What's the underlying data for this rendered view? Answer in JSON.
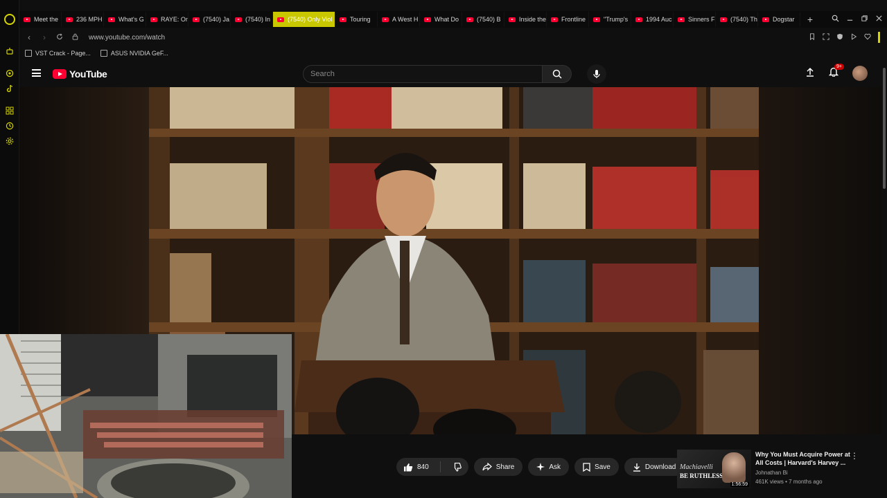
{
  "browser": {
    "tabs": [
      {
        "label": "Meet the",
        "active": false
      },
      {
        "label": "236 MPH",
        "active": false
      },
      {
        "label": "What's G",
        "active": false
      },
      {
        "label": "RAYE: On",
        "active": false
      },
      {
        "label": "(7540) Ja",
        "active": false
      },
      {
        "label": "(7540) In",
        "active": false
      },
      {
        "label": "(7540) Only Viol",
        "active": true
      },
      {
        "label": "Touring",
        "active": false
      },
      {
        "label": "A West H",
        "active": false
      },
      {
        "label": "What Do",
        "active": false
      },
      {
        "label": "(7540) B",
        "active": false
      },
      {
        "label": "Inside the",
        "active": false
      },
      {
        "label": "Frontline",
        "active": false
      },
      {
        "label": "\"Trump's",
        "active": false
      },
      {
        "label": "1994 Auc",
        "active": false
      },
      {
        "label": "Sinners F",
        "active": false
      },
      {
        "label": "(7540) Th",
        "active": false
      },
      {
        "label": "Dogstar",
        "active": false
      }
    ],
    "url": "www.youtube.com/watch",
    "bookmarks": [
      {
        "label": "VST Crack - Page..."
      },
      {
        "label": "ASUS NVIDIA GeF..."
      }
    ],
    "accent_color": "#d7d600"
  },
  "youtube": {
    "logo_text": "YouTube",
    "search_placeholder": "Search",
    "notification_count": "9+",
    "actions": {
      "like_count": "840",
      "share_label": "Share",
      "ask_label": "Ask",
      "save_label": "Save",
      "download_label": "Download"
    },
    "recommendation": {
      "title": "Why You Must Acquire Power at All Costs | Harvard's Harvey ...",
      "channel": "Johnathan Bi",
      "meta": "461K views • 7 months ago",
      "thumb_line1": "Machiavelli",
      "thumb_line2": "BE RUTHLESS",
      "duration": "1:56:59"
    }
  }
}
